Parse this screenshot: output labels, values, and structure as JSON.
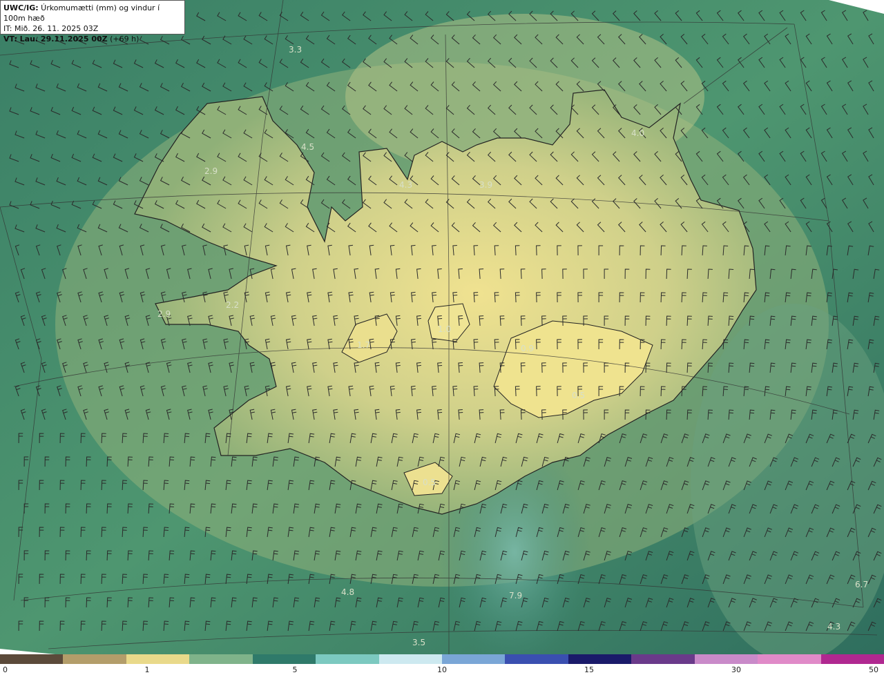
{
  "header": {
    "model_label": "UWC/IG:",
    "title": " Úrkomumætti (mm) og vindur í 100m hæð",
    "init_time": "IT: Mið. 26. 11. 2025 03Z",
    "valid_prefix": "VT: Lau. 29.11.2025 00Z",
    "valid_suffix": " (+69 h)"
  },
  "map": {
    "value_labels": [
      "3.3",
      "4.5",
      "2.9",
      "4.3",
      "3.9",
      "4.0",
      "2.9",
      "2.2",
      "1.0",
      "1.7",
      "0.9",
      "0.5",
      "0.5",
      "4.8",
      "7.9",
      "3.5",
      "6.7",
      "4.3"
    ],
    "colors": {
      "sea_dark": "#2f7060",
      "sea_mid": "#3f8a6a",
      "land_low": "#a8c07a",
      "land_high": "#ecdf8e",
      "coastline": "#222222",
      "barb": "#2a2a2a"
    }
  },
  "colorbar": {
    "ticks": [
      "0",
      "1",
      "5",
      "10",
      "15",
      "30",
      "50"
    ],
    "segments": [
      "#5b4a3a",
      "#b39d6a",
      "#e9d98a",
      "#7fb38a",
      "#2f7a6a",
      "#7cc9c0",
      "#cde9f0",
      "#7aa6d6",
      "#3a4fb0",
      "#1a1a6a",
      "#6a3a8a",
      "#c98ac9",
      "#e08ac8",
      "#b02890"
    ]
  }
}
